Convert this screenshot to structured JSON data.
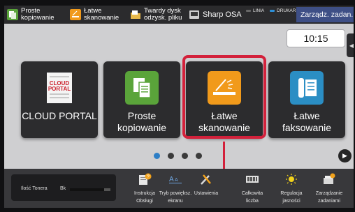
{
  "topbar": {
    "items": [
      {
        "label_line1": "Proste",
        "label_line2": "kopiowanie",
        "icon": "copy-icon"
      },
      {
        "label_line1": "Łatwe",
        "label_line2": "skanowanie",
        "icon": "scan-icon"
      },
      {
        "label_line1": "Twardy dysk",
        "label_line2": "odzysk. pliku",
        "icon": "folder-icon"
      },
      {
        "label": "Sharp OSA",
        "icon": "sharp-osa-icon"
      }
    ],
    "linia_label": "LINIA",
    "drukarka_label": "DRUKARKA",
    "job_status_button": "Zarządz. zadan."
  },
  "clock": {
    "time": "10:15"
  },
  "tiles": [
    {
      "label_line1": "CLOUD PORTAL",
      "label_line2": "",
      "icon": "cloud-portal-icon",
      "icon_text_1": "CLOUD",
      "icon_text_2": "PORTAL"
    },
    {
      "label_line1": "Proste",
      "label_line2": "kopiowanie",
      "icon": "copy-icon",
      "color": "#5aa43a"
    },
    {
      "label_line1": "Łatwe",
      "label_line2": "skanowanie",
      "icon": "scan-icon",
      "color": "#f19a1b"
    },
    {
      "label_line1": "Łatwe",
      "label_line2": "faksowanie",
      "icon": "fax-icon",
      "color": "#2b8ec4"
    }
  ],
  "page_indicator": {
    "pages": 4,
    "current": 1
  },
  "bottombar": {
    "toner": {
      "label": "Ilość Tonera",
      "color_label": "Bk",
      "level": 0.85
    },
    "items": [
      {
        "label_line1": "Instrukcja",
        "label_line2": "Obsługi",
        "icon": "manual-icon"
      },
      {
        "label_line1": "Tryb powiększ.",
        "label_line2": "ekranu",
        "icon": "zoom-text-icon"
      },
      {
        "label_line1": "Ustawienia",
        "label_line2": "",
        "icon": "settings-tools-icon"
      },
      {
        "label_line1": "Całkowita",
        "label_line2": "liczba",
        "icon": "counter-icon"
      },
      {
        "label_line1": "Regulacja",
        "label_line2": "jasności",
        "icon": "brightness-icon"
      },
      {
        "label_line1": "Zarządzanie",
        "label_line2": "zadaniami",
        "icon": "job-status-icon"
      }
    ]
  }
}
